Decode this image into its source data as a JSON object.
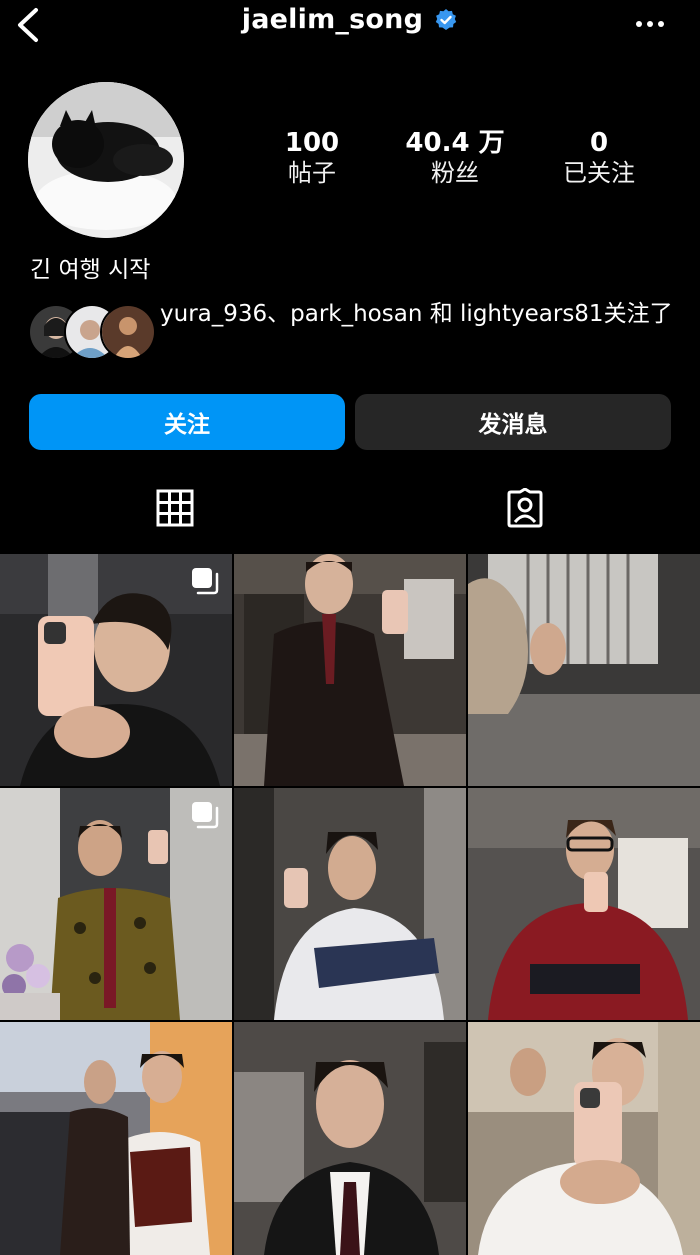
{
  "header": {
    "username": "jaelim_song",
    "back_icon": "chevron-left-icon",
    "more_icon": "more-horizontal-icon",
    "verified_color": "#3897f0"
  },
  "profile": {
    "stats": [
      {
        "value": "100",
        "label": "帖子"
      },
      {
        "value": "40.4 万",
        "label": "粉丝"
      },
      {
        "value": "0",
        "label": "已关注"
      }
    ],
    "bio": "긴 여행 시작",
    "mutual_text": "yura_936、park_hosan 和 lightyears81关注了"
  },
  "actions": {
    "follow_label": "关注",
    "message_label": "发消息",
    "follow_color": "#0095f6"
  },
  "tabs": [
    "grid-icon",
    "tagged-icon"
  ]
}
